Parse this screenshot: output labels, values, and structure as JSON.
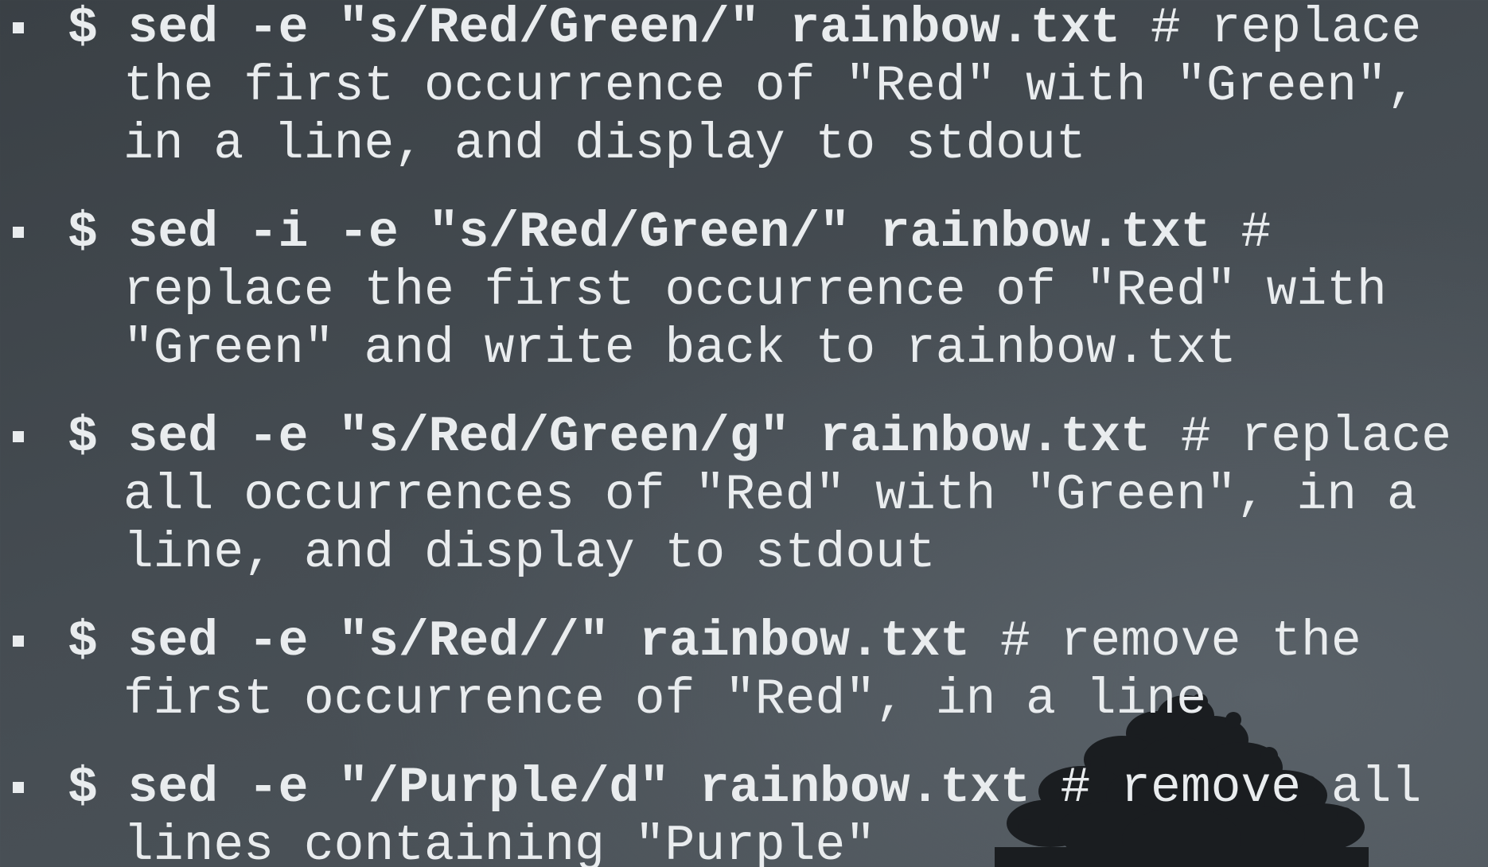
{
  "commands": [
    {
      "code": "$ sed -e \"s/Red/Green/\" rainbow.txt",
      "comment": "# replace the first occurrence of \"Red\" with \"Green\", in a line, and display to stdout"
    },
    {
      "code": "$ sed -i -e \"s/Red/Green/\" rainbow.txt",
      "comment": "# replace the first occurrence of \"Red\" with \"Green\" and write back to rainbow.txt"
    },
    {
      "code": "$ sed -e \"s/Red/Green/g\" rainbow.txt",
      "comment": "# replace all occurrences of \"Red\" with \"Green\", in a line, and display to stdout"
    },
    {
      "code": "$ sed -e \"s/Red//\" rainbow.txt",
      "comment": "# remove the first occurrence of \"Red\", in a line"
    },
    {
      "code": "$ sed -e \"/Purple/d\" rainbow.txt",
      "comment": "# remove all lines containing \"Purple\""
    }
  ],
  "colors": {
    "text": "#e9ecee",
    "background": "#454c52",
    "tree": "#1a1d20"
  },
  "icons": {
    "bullet": "square-bullet-icon",
    "background_image": "tree-silhouette"
  }
}
